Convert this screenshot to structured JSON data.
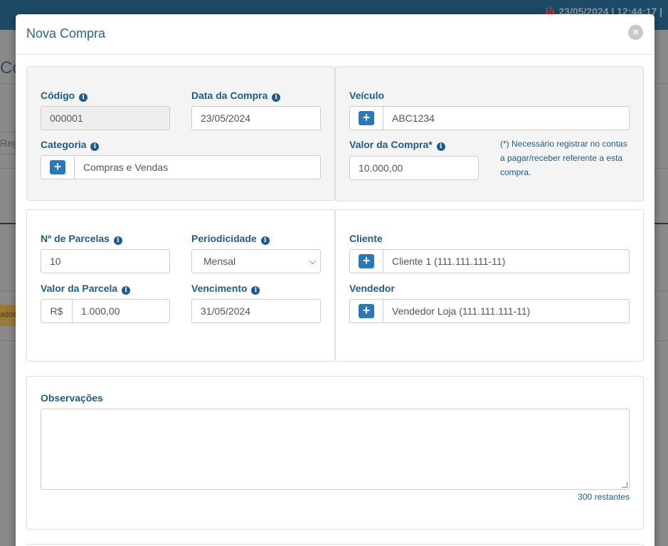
{
  "background": {
    "status_text": "🐞 23/05/2024  |  12:44:17 |",
    "page_title_partial": "Co",
    "search_partial": "Reg",
    "orange_button_partial": "ados"
  },
  "modal": {
    "title": "Nova Compra",
    "close_icon": "close-icon"
  },
  "fields": {
    "codigo": {
      "label": "Código",
      "value": "000001"
    },
    "data_compra": {
      "label": "Data da Compra",
      "value": "23/05/2024"
    },
    "categoria": {
      "label": "Categoria",
      "value": "Compras e Vendas"
    },
    "veiculo": {
      "label": "Veículo",
      "value": "ABC1234"
    },
    "valor_compra": {
      "label": "Valor da Compra*",
      "value": "10.000,00"
    },
    "valor_compra_note": "(*) Necessário registrar no contas a pagar/receber referente a esta compra.",
    "num_parcelas": {
      "label": "Nº de Parcelas",
      "value": "10"
    },
    "periodicidade": {
      "label": "Periodicidade",
      "value": "Mensal"
    },
    "valor_parcela": {
      "label": "Valor da Parcela",
      "currency": "R$",
      "value": "1.000,00"
    },
    "vencimento": {
      "label": "Vencimento",
      "value": "31/05/2024"
    },
    "cliente": {
      "label": "Cliente",
      "value": "Cliente 1 (111.111.111-11)"
    },
    "vendedor": {
      "label": "Vendedor",
      "value": "Vendedor Loja (111.111.111-11)"
    },
    "observacoes": {
      "label": "Observações",
      "value": "",
      "counter": "300 restantes"
    }
  },
  "icons": {
    "info": "i",
    "plus": "+",
    "chevron": "chevron-down-icon"
  },
  "colors": {
    "accent": "#1f5c8c",
    "button": "#2a78b8",
    "header_bar": "#1d4a66"
  }
}
